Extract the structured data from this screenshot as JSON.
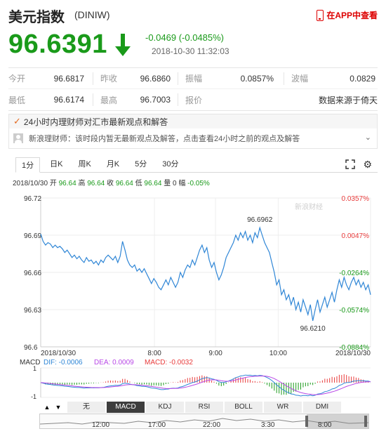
{
  "header": {
    "title": "美元指数",
    "code": "(DINIW)",
    "app_link": "在APP中查看"
  },
  "quote": {
    "price": "96.6391",
    "change": "-0.0469 (-0.0485%)",
    "timestamp": "2018-10-30 11:32:03"
  },
  "stats": [
    [
      {
        "label": "今开",
        "value": "96.6817"
      },
      {
        "label": "昨收",
        "value": "96.6860"
      },
      {
        "label": "振幅",
        "value": "0.0857%"
      },
      {
        "label": "波幅",
        "value": "0.0829"
      }
    ],
    [
      {
        "label": "最低",
        "value": "96.6174"
      },
      {
        "label": "最高",
        "value": "96.7003"
      },
      {
        "label": "报价",
        "value": ""
      },
      {
        "label": "",
        "value": "数据来源于倚天"
      }
    ]
  ],
  "news": {
    "headline": "24小时内理财师对汇市最新观点和解答",
    "body": "新浪理财师：该时段内暂无最新观点及解答，点击查看24小时之前的观点及解答"
  },
  "tabs": [
    "1分",
    "日K",
    "周K",
    "月K",
    "5分",
    "30分"
  ],
  "chart_info": {
    "date": "2018/10/30",
    "open_label": "开",
    "open": "96.64",
    "high_label": "高",
    "high": "96.64",
    "close_label": "收",
    "close": "96.64",
    "low_label": "低",
    "low": "96.64",
    "volume_label": "量",
    "volume": "0",
    "amp_label": "幅",
    "amp": "-0.05%"
  },
  "watermark": "新浪财经",
  "macd_info": {
    "name": "MACD",
    "dif": "DIF: -0.0006",
    "dea": "DEA: 0.0009",
    "macd": "MACD: -0.0032"
  },
  "indicator_tabs": [
    "无",
    "MACD",
    "KDJ",
    "RSI",
    "BOLL",
    "WR",
    "DMI"
  ],
  "mini_nav_labels": [
    "12:00",
    "17:00",
    "22:00",
    "3:30",
    "8:00"
  ],
  "colors": {
    "up": "#e83b3b",
    "down": "#1a9a1a",
    "line": "#2f86d6"
  },
  "chart_data": {
    "type": "line",
    "title": "",
    "xlabel": "",
    "ylabel": "",
    "x_ticks": [
      "2018/10/30",
      "8:00",
      "9:00",
      "10:00",
      "2018/10/30"
    ],
    "y_ticks_left": [
      "96.72",
      "96.69",
      "96.66",
      "96.63",
      "96.6"
    ],
    "y_ticks_right": [
      "0.0357%",
      "0.0047%",
      "-0.0264%",
      "-0.0574%",
      "-0.0884%"
    ],
    "ylim": [
      96.6,
      96.72
    ],
    "annotations": [
      {
        "label": "96.6962",
        "x_index": 91,
        "y": 96.6962
      },
      {
        "label": "96.6210",
        "x_index": 113,
        "y": 96.621
      }
    ],
    "series": [
      {
        "values": [
          96.691,
          96.685,
          96.682,
          96.684,
          96.683,
          96.68,
          96.682,
          96.68,
          96.681,
          96.679,
          96.676,
          96.678,
          96.675,
          96.672,
          96.674,
          96.671,
          96.673,
          96.67,
          96.668,
          96.672,
          96.669,
          96.67,
          96.667,
          96.669,
          96.666,
          96.67,
          96.668,
          96.672,
          96.674,
          96.672,
          96.67,
          96.673,
          96.668,
          96.673,
          96.685,
          96.678,
          96.67,
          96.666,
          96.664,
          96.666,
          96.661,
          96.663,
          96.66,
          96.663,
          96.659,
          96.655,
          96.651,
          96.655,
          96.652,
          96.648,
          96.646,
          96.65,
          96.654,
          96.65,
          96.656,
          96.652,
          96.648,
          96.652,
          96.66,
          96.656,
          96.662,
          96.666,
          96.664,
          96.67,
          96.666,
          96.672,
          96.678,
          96.682,
          96.676,
          96.68,
          96.67,
          96.664,
          96.668,
          96.66,
          96.654,
          96.658,
          96.664,
          96.672,
          96.676,
          96.68,
          96.684,
          96.69,
          96.686,
          96.692,
          96.688,
          96.693,
          96.686,
          96.69,
          96.684,
          96.692,
          96.688,
          96.696,
          96.69,
          96.684,
          96.68,
          96.676,
          96.668,
          96.66,
          96.65,
          96.654,
          96.642,
          96.646,
          96.638,
          96.642,
          96.634,
          96.64,
          96.63,
          96.636,
          96.628,
          96.638,
          96.632,
          96.626,
          96.634,
          96.621,
          96.63,
          96.638,
          96.628,
          96.634,
          96.64,
          96.632,
          96.638,
          96.644,
          96.636,
          96.646,
          96.654,
          96.648,
          96.656,
          96.65,
          96.646,
          96.652,
          96.656,
          96.65,
          96.654,
          96.648,
          96.652,
          96.646,
          96.65,
          96.642
        ]
      }
    ]
  }
}
